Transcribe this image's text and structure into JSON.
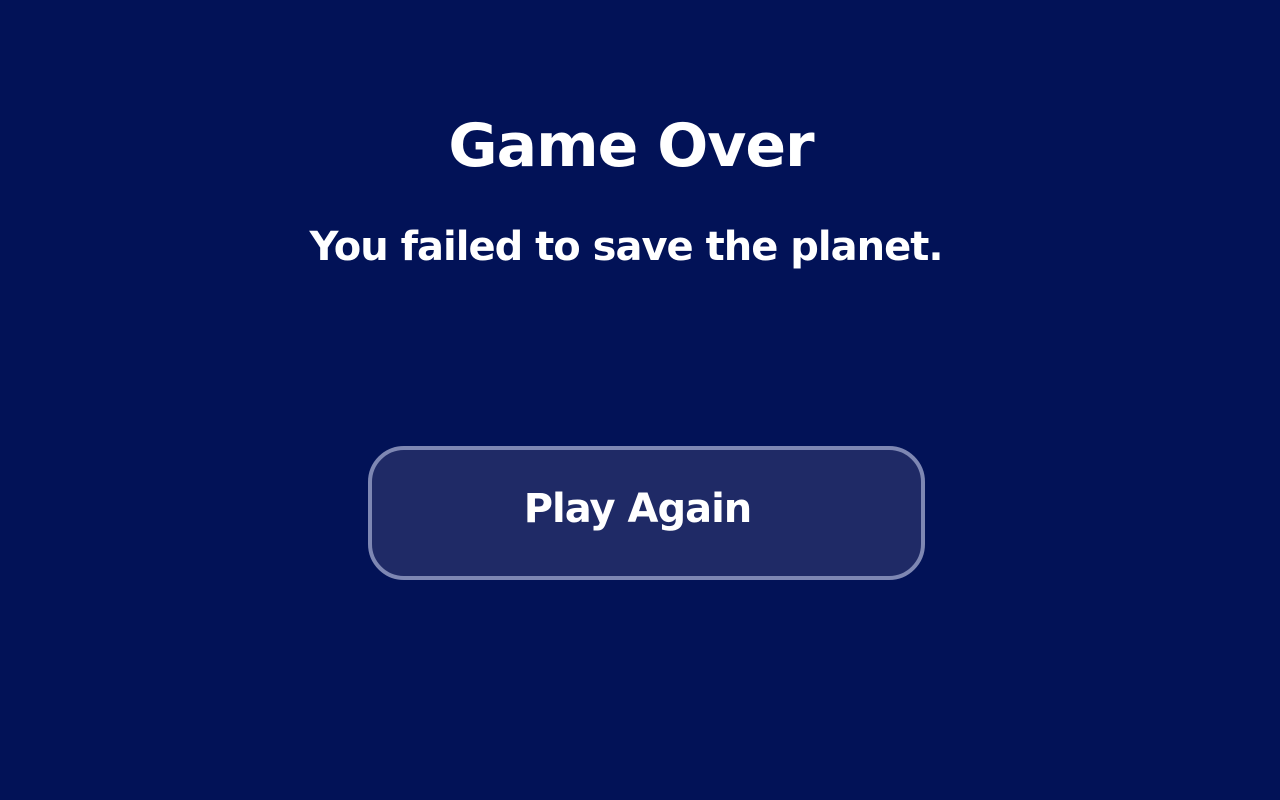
{
  "screen": {
    "title": "Game Over",
    "message": "You failed to save the planet.",
    "play_again_label": "Play Again"
  },
  "colors": {
    "background": "#021257",
    "text": "#ffffff",
    "button_fill": "#1f2a66",
    "button_border": "#7e87b3"
  }
}
